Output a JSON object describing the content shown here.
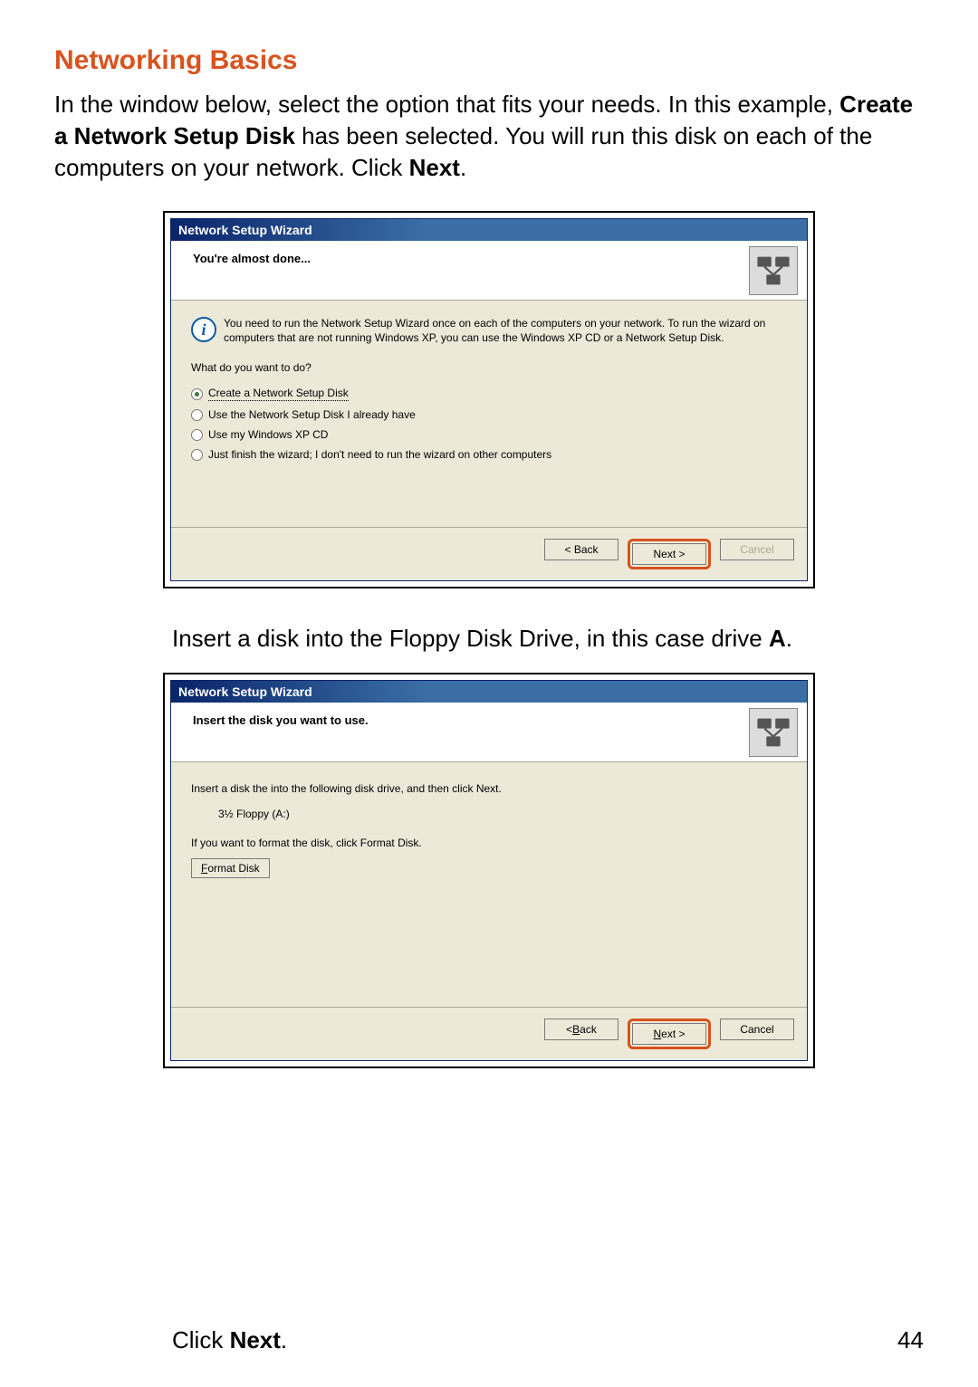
{
  "heading": "Networking Basics",
  "intro": {
    "part1": "In the window below, select the option that fits your needs. In this example, ",
    "bold1": "Create a Network Setup Disk",
    "part2": " has been selected.  You will run this disk on each of the computers on your network. Click ",
    "bold2": "Next",
    "part3": "."
  },
  "wizard1": {
    "title": "Network Setup Wizard",
    "header": "You're almost done...",
    "info": "You need to run the Network Setup Wizard once on each of the computers on your network. To run the wizard on computers that are not running Windows XP, you can use the Windows XP CD or a Network Setup Disk.",
    "prompt": "What do you want to do?",
    "options": [
      "Create a Network Setup Disk",
      "Use the Network Setup Disk I already have",
      "Use my Windows XP CD",
      "Just finish the wizard; I don't need to run the wizard on other computers"
    ],
    "selected": 0,
    "back": "< Back",
    "next": "Next >",
    "cancel": "Cancel"
  },
  "mid_caption": {
    "part1": "Insert a disk into the Floppy Disk Drive, in this case drive ",
    "bold": "A",
    "part2": "."
  },
  "wizard2": {
    "title": "Network Setup Wizard",
    "header": "Insert the disk you want to use.",
    "line1": "Insert a disk the into the following disk drive, and then click Next.",
    "drive": "3½ Floppy (A:)",
    "line2": "If you want to format the disk, click Format Disk.",
    "format": "Format Disk",
    "back": "< Back",
    "next": "Next >",
    "cancel": "Cancel"
  },
  "click_next": {
    "part1": "Click ",
    "bold": "Next",
    "part2": "."
  },
  "page_number": "44"
}
